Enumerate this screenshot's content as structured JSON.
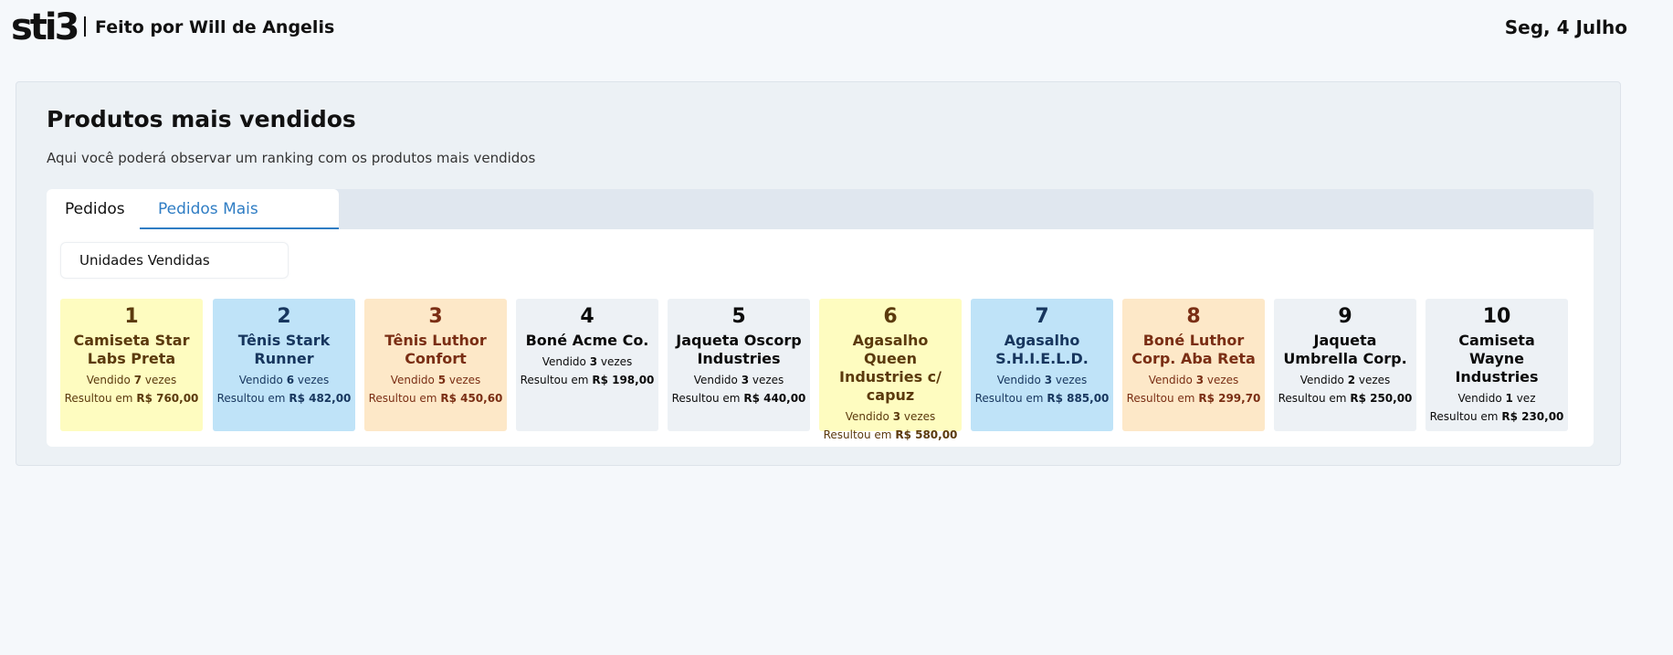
{
  "header": {
    "logo": "sti3",
    "credit": "Feito por Will de Angelis",
    "date": "Seg, 4 Julho"
  },
  "page": {
    "title": "Produtos mais vendidos",
    "description": "Aqui você poderá observar um ranking com os produtos mais vendidos"
  },
  "tabs": [
    {
      "label": "Pedidos",
      "active": false
    },
    {
      "label": "Pedidos Mais Vendidos",
      "active": true
    }
  ],
  "filter": {
    "label": "Unidades Vendidas"
  },
  "colors": {
    "yellow": "#fefcc0",
    "blue": "#bfe3f8",
    "peach": "#fde8c8",
    "gray": "#edf1f5",
    "accent": "#2f7dc4"
  },
  "products": [
    {
      "rank": "1",
      "name": "Camiseta Star Labs Preta",
      "sold_prefix": "Vendido",
      "sold_count": "7",
      "sold_suffix": "vezes",
      "result_prefix": "Resultou em",
      "result_value": "R$ 760,00"
    },
    {
      "rank": "2",
      "name": "Tênis Stark Runner",
      "sold_prefix": "Vendido",
      "sold_count": "6",
      "sold_suffix": "vezes",
      "result_prefix": "Resultou em",
      "result_value": "R$ 482,00"
    },
    {
      "rank": "3",
      "name": "Tênis Luthor Confort",
      "sold_prefix": "Vendido",
      "sold_count": "5",
      "sold_suffix": "vezes",
      "result_prefix": "Resultou em",
      "result_value": "R$ 450,60"
    },
    {
      "rank": "4",
      "name": "Boné Acme Co.",
      "sold_prefix": "Vendido",
      "sold_count": "3",
      "sold_suffix": "vezes",
      "result_prefix": "Resultou em",
      "result_value": "R$ 198,00"
    },
    {
      "rank": "5",
      "name": "Jaqueta Oscorp Industries",
      "sold_prefix": "Vendido",
      "sold_count": "3",
      "sold_suffix": "vezes",
      "result_prefix": "Resultou em",
      "result_value": "R$ 440,00"
    },
    {
      "rank": "6",
      "name": "Agasalho Queen Industries c/ capuz",
      "sold_prefix": "Vendido",
      "sold_count": "3",
      "sold_suffix": "vezes",
      "result_prefix": "Resultou em",
      "result_value": "R$ 580,00"
    },
    {
      "rank": "7",
      "name": "Agasalho S.H.I.E.L.D.",
      "sold_prefix": "Vendido",
      "sold_count": "3",
      "sold_suffix": "vezes",
      "result_prefix": "Resultou em",
      "result_value": "R$ 885,00"
    },
    {
      "rank": "8",
      "name": "Boné Luthor Corp. Aba Reta",
      "sold_prefix": "Vendido",
      "sold_count": "3",
      "sold_suffix": "vezes",
      "result_prefix": "Resultou em",
      "result_value": "R$ 299,70"
    },
    {
      "rank": "9",
      "name": "Jaqueta Umbrella Corp.",
      "sold_prefix": "Vendido",
      "sold_count": "2",
      "sold_suffix": "vezes",
      "result_prefix": "Resultou em",
      "result_value": "R$ 250,00"
    },
    {
      "rank": "10",
      "name": "Camiseta Wayne Industries",
      "sold_prefix": "Vendido",
      "sold_count": "1",
      "sold_suffix": "vez",
      "result_prefix": "Resultou em",
      "result_value": "R$ 230,00"
    }
  ]
}
